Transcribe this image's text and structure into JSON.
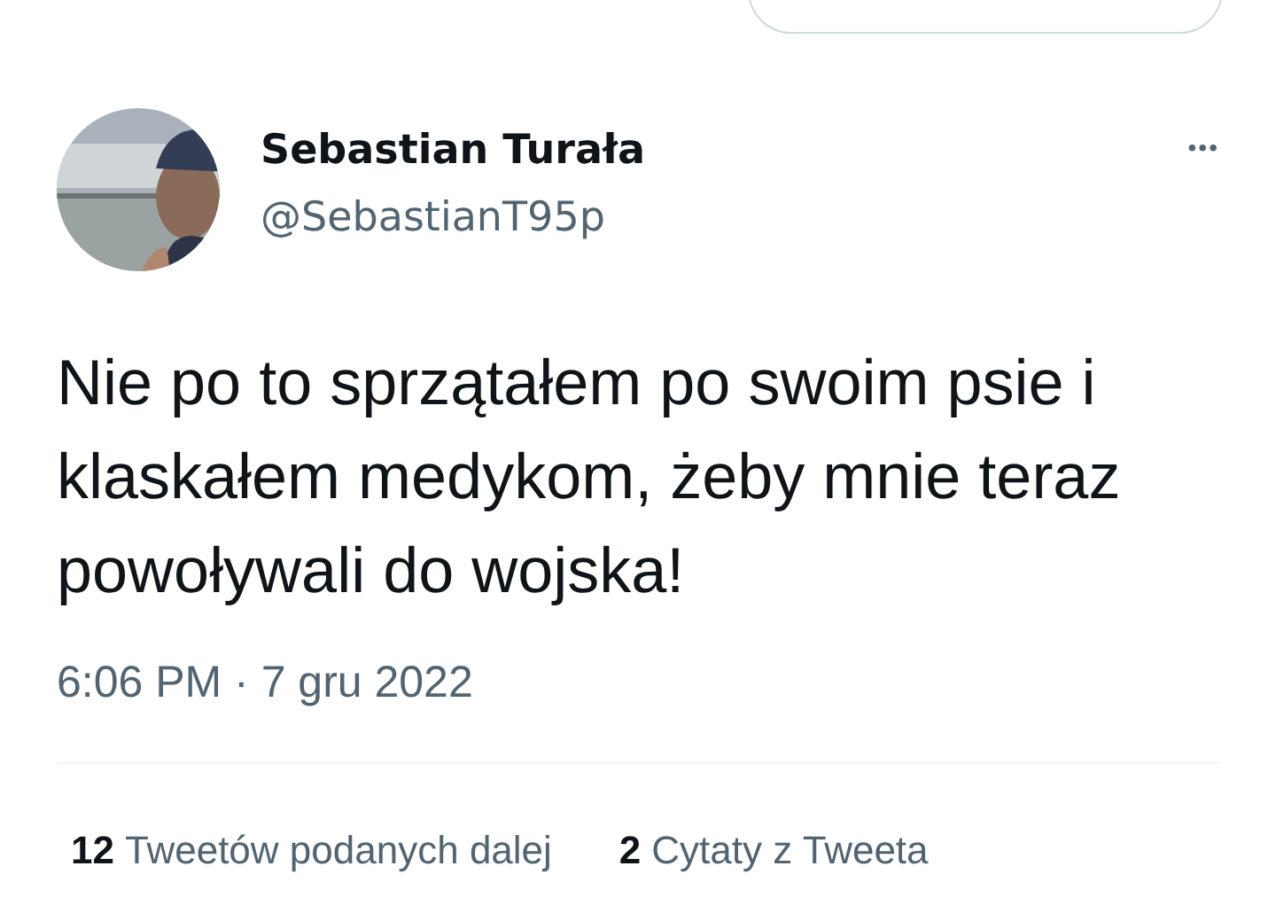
{
  "author": {
    "name": "Sebastian Turała",
    "handle": "@SebastianT95p"
  },
  "more_menu": "•••",
  "tweet": {
    "text": "Nie po to sprzątałem po swoim psie i klaskałem medykom, żeby mnie teraz powoływali do wojska!",
    "timestamp": "6:06 PM · 7 gru 2022"
  },
  "stats": [
    {
      "count": "12",
      "label": "Tweetów podanych dalej"
    },
    {
      "count": "2",
      "label": "Cytaty z Tweeta"
    }
  ]
}
